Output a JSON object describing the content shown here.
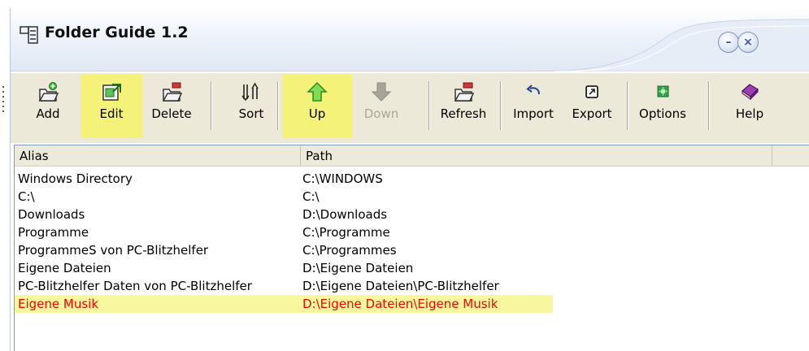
{
  "window": {
    "title": "Folder Guide 1.2",
    "minimize_symbol": "–",
    "close_symbol": "×"
  },
  "toolbar": {
    "buttons": [
      {
        "label": "Add",
        "icon": "add-folder-icon",
        "highlighted": false,
        "enabled": true
      },
      {
        "label": "Edit",
        "icon": "edit-folder-icon",
        "highlighted": true,
        "enabled": true
      },
      {
        "label": "Delete",
        "icon": "delete-folder-icon",
        "highlighted": false,
        "enabled": true
      },
      {
        "label": "Sort",
        "icon": "sort-icon",
        "highlighted": false,
        "enabled": true
      },
      {
        "label": "Up",
        "icon": "arrow-up-icon",
        "highlighted": true,
        "enabled": true
      },
      {
        "label": "Down",
        "icon": "arrow-down-icon",
        "highlighted": false,
        "enabled": false
      },
      {
        "label": "Refresh",
        "icon": "refresh-folder-icon",
        "highlighted": false,
        "enabled": true
      },
      {
        "label": "Import",
        "icon": "import-icon",
        "highlighted": false,
        "enabled": true
      },
      {
        "label": "Export",
        "icon": "export-icon",
        "highlighted": false,
        "enabled": true
      },
      {
        "label": "Options",
        "icon": "options-icon",
        "highlighted": false,
        "enabled": true
      },
      {
        "label": "Help",
        "icon": "help-book-icon",
        "highlighted": false,
        "enabled": true
      }
    ]
  },
  "list": {
    "columns": {
      "alias": "Alias",
      "path": "Path"
    },
    "rows": [
      {
        "alias": "Windows Directory",
        "path": "C:\\WINDOWS"
      },
      {
        "alias": "C:\\",
        "path": "C:\\"
      },
      {
        "alias": "Downloads",
        "path": "D:\\Downloads"
      },
      {
        "alias": "Programme",
        "path": "C:\\Programme"
      },
      {
        "alias": "ProgrammeS  von PC-Blitzhelfer",
        "path": "C:\\Programmes"
      },
      {
        "alias": "Eigene Dateien",
        "path": "D:\\Eigene Dateien"
      },
      {
        "alias": "PC-Blitzhelfer  Daten von PC-Blitzhelfer",
        "path": "D:\\Eigene Dateien\\PC-Blitzhelfer"
      },
      {
        "alias": "Eigene Musik",
        "path": "D:\\Eigene Dateien\\Eigene Musik"
      }
    ],
    "selected_index": 7
  },
  "colors": {
    "toolbar_bg": "#ece9d8",
    "highlight": "#f5f27a",
    "selected_text": "#ff0000"
  }
}
